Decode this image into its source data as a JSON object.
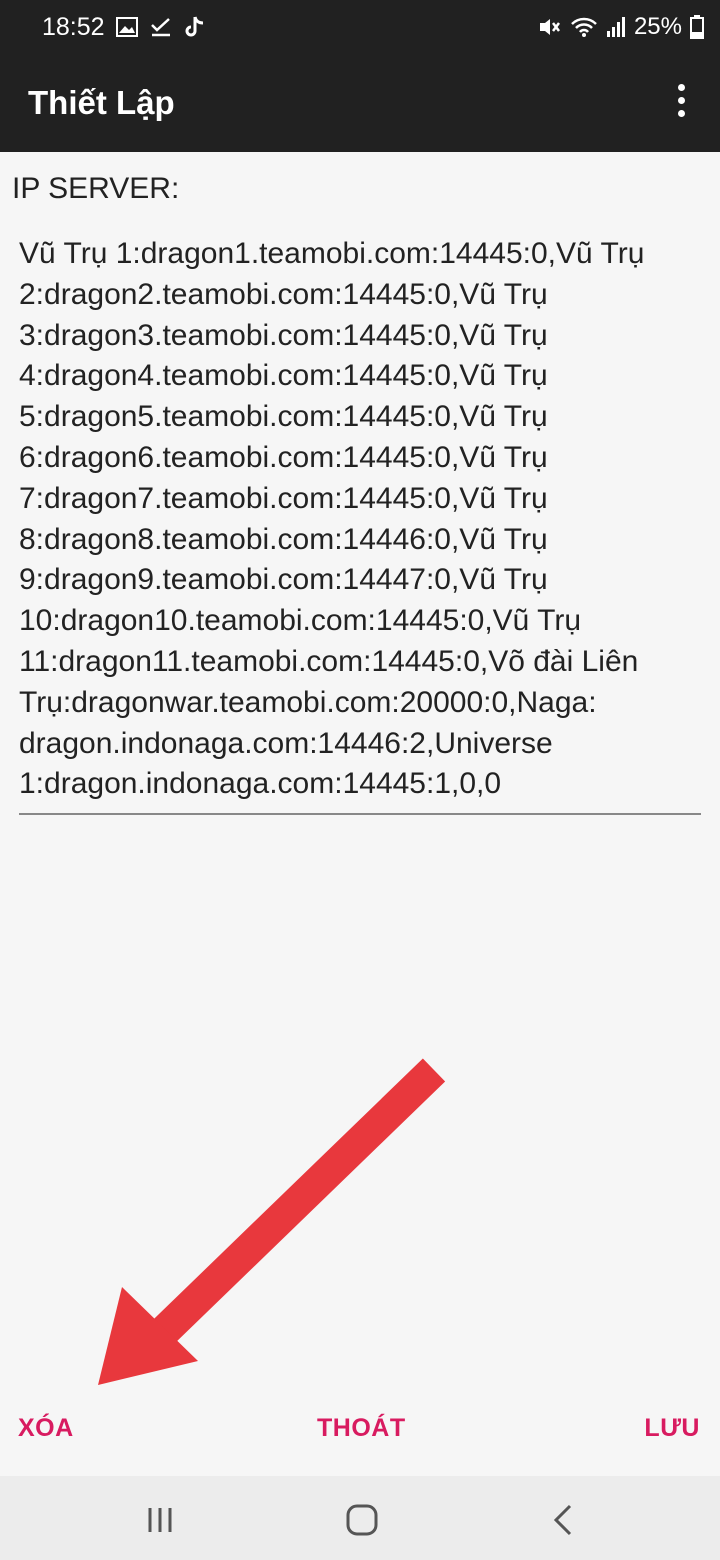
{
  "status_bar": {
    "time": "18:52",
    "battery": "25%",
    "icons_left": [
      "image-icon",
      "check-icon",
      "tiktok-icon"
    ],
    "icons_right": [
      "mute-icon",
      "wifi-icon",
      "signal-icon",
      "battery-icon"
    ]
  },
  "app_bar": {
    "title": "Thiết Lập",
    "menu_icon": "more-vertical-icon"
  },
  "form": {
    "label": "IP SERVER:",
    "value": "Vũ Trụ 1:dragon1.teamobi.com:14445:0,Vũ Trụ 2:dragon2.teamobi.com:14445:0,Vũ Trụ 3:dragon3.teamobi.com:14445:0,Vũ Trụ 4:dragon4.teamobi.com:14445:0,Vũ Trụ 5:dragon5.teamobi.com:14445:0,Vũ Trụ 6:dragon6.teamobi.com:14445:0,Vũ Trụ 7:dragon7.teamobi.com:14445:0,Vũ Trụ 8:dragon8.teamobi.com:14446:0,Vũ Trụ 9:dragon9.teamobi.com:14447:0,Vũ Trụ 10:dragon10.teamobi.com:14445:0,Vũ Trụ 11:dragon11.teamobi.com:14445:0,Võ đài Liên Trụ:dragonwar.teamobi.com:20000:0,Naga: dragon.indonaga.com:14446:2,Universe 1:dragon.indonaga.com:14445:1,0,0"
  },
  "actions": {
    "delete_label": "XÓA",
    "exit_label": "THOÁT",
    "save_label": "LƯU"
  },
  "colors": {
    "bar_bg": "#212121",
    "accent": "#d81b60",
    "annotation_arrow": "#e8383d"
  },
  "nav_bar": {
    "icons": [
      "recents-icon",
      "home-icon",
      "back-icon"
    ]
  }
}
